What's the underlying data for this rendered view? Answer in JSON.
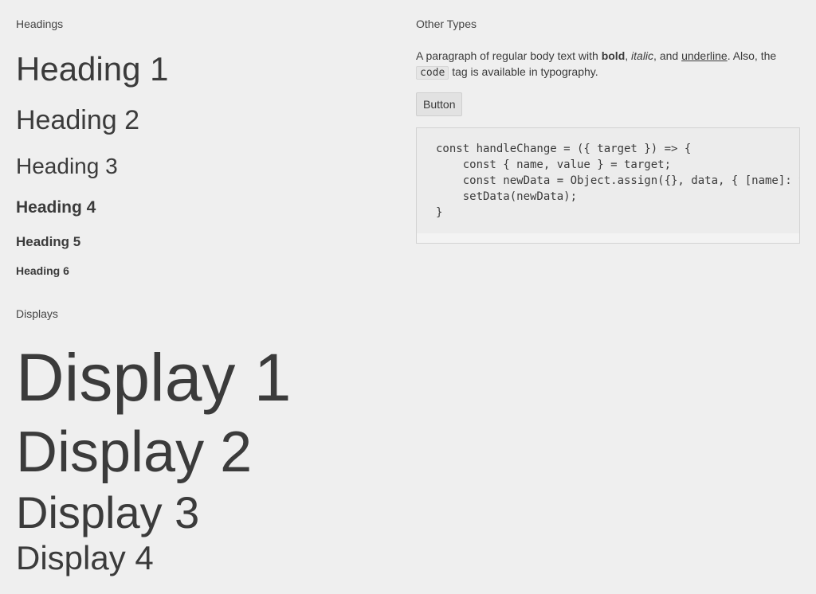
{
  "headings_section": {
    "label": "Headings",
    "h1": "Heading 1",
    "h2": "Heading 2",
    "h3": "Heading 3",
    "h4": "Heading 4",
    "h5": "Heading 5",
    "h6": "Heading 6"
  },
  "displays_section": {
    "label": "Displays",
    "d1": "Display 1",
    "d2": "Display 2",
    "d3": "Display 3",
    "d4": "Display 4"
  },
  "other_section": {
    "label": "Other Types",
    "paragraph": {
      "part1": "A paragraph of regular body text with ",
      "bold": "bold",
      "part2": ", ",
      "italic": "italic",
      "part3": ", and ",
      "underline": "underline",
      "part4": ". Also, the ",
      "code": "code",
      "part5": " tag is available in typography."
    },
    "button_label": "Button",
    "code_block": "const handleChange = ({ target }) => {\n    const { name, value } = target;\n    const newData = Object.assign({}, data, { [name]: value });\n    setData(newData);\n}"
  }
}
